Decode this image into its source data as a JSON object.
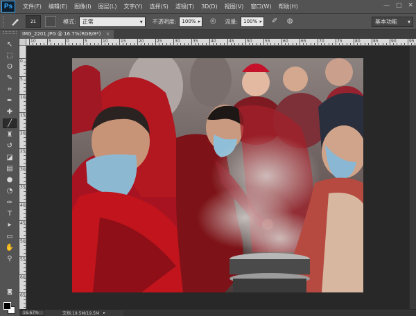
{
  "app": {
    "logo": "Ps"
  },
  "menu": [
    {
      "label": "文件(F)"
    },
    {
      "label": "编辑(E)"
    },
    {
      "label": "图像(I)"
    },
    {
      "label": "图层(L)"
    },
    {
      "label": "文字(Y)"
    },
    {
      "label": "选择(S)"
    },
    {
      "label": "滤镜(T)"
    },
    {
      "label": "3D(D)"
    },
    {
      "label": "视图(V)"
    },
    {
      "label": "窗口(W)"
    },
    {
      "label": "帮助(H)"
    }
  ],
  "window_controls": {
    "minimize": "—",
    "maximize": "□",
    "close": "✕"
  },
  "options": {
    "brush_size": "21",
    "mode_label": "模式:",
    "mode_value": "正常",
    "opacity_label": "不透明度:",
    "opacity_value": "100%",
    "flow_label": "流量:",
    "flow_value": "100%",
    "workspace": "基本功能"
  },
  "document": {
    "tab_title": "IMG_2201.JPG @ 16.7%(RGB/8*)",
    "close": "×",
    "zoom": "16.67%",
    "info": "文档:19.5M/19.5M"
  },
  "rulers": {
    "top": [
      "10",
      "5",
      "0",
      "5",
      "10",
      "15",
      "20",
      "25",
      "30",
      "35",
      "40",
      "45",
      "50",
      "55",
      "60",
      "65",
      "70",
      "75",
      "80",
      "85",
      "90",
      "95"
    ],
    "left": [
      "0",
      "5",
      "10",
      "15",
      "20",
      "25",
      "30",
      "35",
      "40",
      "45",
      "50",
      "55",
      "60",
      "65",
      "70"
    ]
  },
  "toolbox": {
    "tools": [
      {
        "name": "move-tool",
        "glyph": "↖"
      },
      {
        "name": "marquee-tool",
        "glyph": "⬚"
      },
      {
        "name": "lasso-tool",
        "glyph": "ʘ"
      },
      {
        "name": "quick-select-tool",
        "glyph": "✎"
      },
      {
        "name": "crop-tool",
        "glyph": "⌗"
      },
      {
        "name": "eyedropper-tool",
        "glyph": "✒"
      },
      {
        "name": "healing-brush-tool",
        "glyph": "✚"
      },
      {
        "name": "brush-tool",
        "glyph": "╱"
      },
      {
        "name": "clone-stamp-tool",
        "glyph": "♜"
      },
      {
        "name": "history-brush-tool",
        "glyph": "↺"
      },
      {
        "name": "eraser-tool",
        "glyph": "◪"
      },
      {
        "name": "gradient-tool",
        "glyph": "▤"
      },
      {
        "name": "blur-tool",
        "glyph": "●"
      },
      {
        "name": "dodge-tool",
        "glyph": "◔"
      },
      {
        "name": "pen-tool",
        "glyph": "✑"
      },
      {
        "name": "type-tool",
        "glyph": "T"
      },
      {
        "name": "path-select-tool",
        "glyph": "▸"
      },
      {
        "name": "rectangle-tool",
        "glyph": "▭"
      },
      {
        "name": "hand-tool",
        "glyph": "✋"
      },
      {
        "name": "zoom-tool",
        "glyph": "⚲"
      }
    ],
    "quick_mask": "◙",
    "screen_mode": "▣"
  },
  "colors": {
    "accent": "#31a8ff",
    "foreground": "#000000",
    "background": "#ffffff"
  }
}
